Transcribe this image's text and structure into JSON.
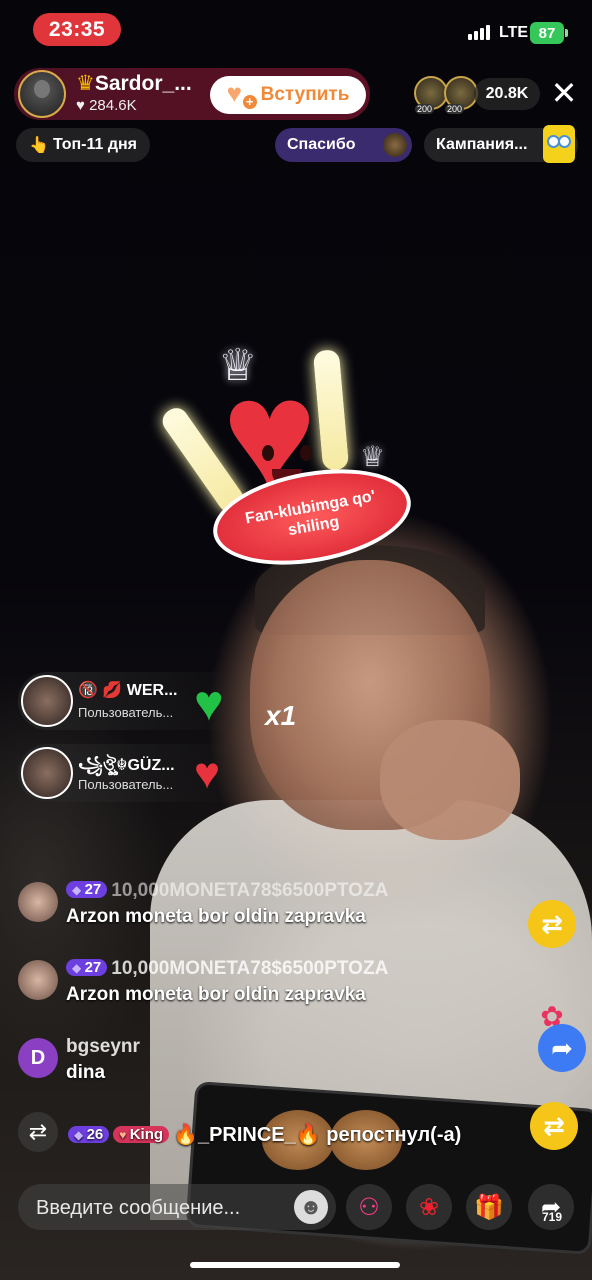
{
  "status_bar": {
    "time": "23:35",
    "network": "LTE",
    "battery": "87"
  },
  "host": {
    "name": "Sardor_...",
    "likes": "284.6K",
    "join_label": "Вступить"
  },
  "viewers": {
    "badge_1": "200",
    "badge_2": "200",
    "count": "20.8K"
  },
  "pills": {
    "top": "Топ-11 дня",
    "thanks": "Спасибо",
    "campaign": "Кампания..."
  },
  "sticker": {
    "line1": "Fan-klubimga qo'",
    "line2": "shiling"
  },
  "gifts": [
    {
      "name": "🔞 💋 WER...",
      "sub": "Пользователь..."
    },
    {
      "name": "꧁ঔৣ☬GÜZ...",
      "sub": "Пользователь..."
    }
  ],
  "gift_multiplier": "x1",
  "chat": [
    {
      "level": "27",
      "meta": "10,000MONETA78$6500PTOZA",
      "message": "Arzon moneta bor oldin zapravka"
    },
    {
      "level": "27",
      "meta": "10,000MONETA78$6500PTOZA",
      "message": "Arzon moneta bor oldin zapravka"
    },
    {
      "avatar_letter": "D",
      "meta": "bgseynr",
      "message": "dina"
    }
  ],
  "repost": {
    "level": "26",
    "badge": "King",
    "name": "🔥_PRINCE_🔥",
    "action": "репостнул(-а)"
  },
  "bottom": {
    "placeholder": "Введите сообщение...",
    "share_count": "719"
  },
  "icons": [
    "close-icon",
    "repost-icon",
    "share-icon",
    "emoji-icon",
    "multi-guest-icon",
    "rose-icon",
    "gift-icon"
  ],
  "colors": {
    "time_pill": "#e0353a",
    "join_text": "#f08a3a",
    "thanks_pill": "#3a2a6e",
    "repost_yellow": "#f5c518",
    "share_blue": "#3d7bf5"
  }
}
